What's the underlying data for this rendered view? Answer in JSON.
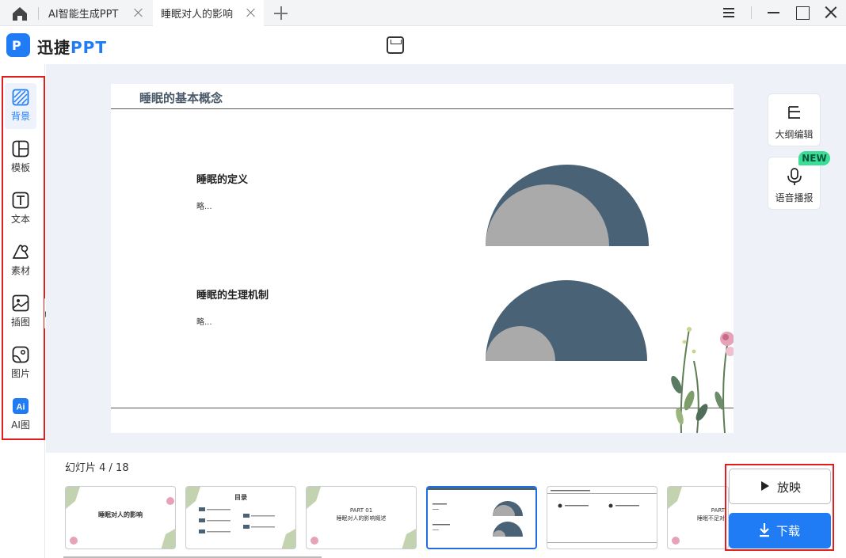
{
  "tabs": [
    {
      "label": "AI智能生成PPT"
    },
    {
      "label": "睡眠对人的影响"
    }
  ],
  "header": {
    "brand_prefix": "迅捷",
    "brand_suffix": "PPT"
  },
  "sidebar": {
    "items": [
      {
        "label": "背景",
        "icon": "background-icon",
        "active": true
      },
      {
        "label": "模板",
        "icon": "template-icon"
      },
      {
        "label": "文本",
        "icon": "text-icon"
      },
      {
        "label": "素材",
        "icon": "material-icon"
      },
      {
        "label": "插图",
        "icon": "illustration-icon"
      },
      {
        "label": "图片",
        "icon": "picture-icon"
      },
      {
        "label": "AI图",
        "icon": "ai-image-icon"
      }
    ]
  },
  "slide": {
    "title": "睡眠的基本概念",
    "sections": [
      {
        "heading": "睡眠的定义",
        "body": "略..."
      },
      {
        "heading": "睡眠的生理机制",
        "body": "略..."
      }
    ],
    "colors": {
      "dark": "#4a6275",
      "gray": "#aaaaaa"
    }
  },
  "right_tools": [
    {
      "label": "大纲编辑",
      "icon": "outline-edit-icon"
    },
    {
      "label": "语音播报",
      "icon": "microphone-icon",
      "badge": "NEW"
    }
  ],
  "bottom": {
    "counter": "幻灯片 4 / 18",
    "thumbnails": [
      {
        "line1": "睡眠对人的影响",
        "line2": ""
      },
      {
        "line1": "目录",
        "line2": ""
      },
      {
        "line1": "PART 01",
        "line2": "睡眠对人的影响概述"
      },
      {
        "line1": "",
        "line2": "",
        "selected": true
      },
      {
        "line1": "",
        "line2": ""
      },
      {
        "line1": "PART",
        "line2": "睡眠不足对"
      }
    ],
    "play_label": "放映",
    "download_label": "下载"
  },
  "accent": "#1f7cf4",
  "highlight": "#e01e1e"
}
